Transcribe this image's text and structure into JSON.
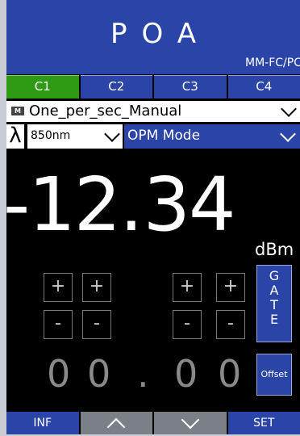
{
  "header": {
    "title": "POA",
    "subtitle": "MM-FC/PC"
  },
  "tabs": [
    {
      "label": "C1",
      "active": true
    },
    {
      "label": "C2",
      "active": false
    },
    {
      "label": "C3",
      "active": false
    },
    {
      "label": "C4",
      "active": false
    }
  ],
  "preset": {
    "badge": "M",
    "label": "One_per_sec_Manual"
  },
  "wavelength": {
    "symbol": "λ",
    "value": "850nm"
  },
  "mode": {
    "value": "OPM Mode"
  },
  "reading": {
    "value": "-12.34",
    "int": "-12",
    "dot": ".",
    "frac": "34",
    "unit": "dBm"
  },
  "adjust": {
    "plus": "+",
    "minus": "-",
    "digits": [
      "0",
      "0",
      ".",
      "0",
      "0"
    ]
  },
  "gate": {
    "letters": [
      "G",
      "A",
      "T",
      "E"
    ]
  },
  "offset_label": "Offset",
  "bottom": {
    "inf": "INF",
    "set": "SET"
  },
  "colors": {
    "accent": "#2b44a8",
    "active_tab": "#2f9a14",
    "background": "#000000",
    "disabled": "#7b7f86"
  },
  "icons": [
    "memory-badge-icon",
    "chevron-down-icon",
    "lambda-icon",
    "up-arrow-icon",
    "down-arrow-icon"
  ]
}
